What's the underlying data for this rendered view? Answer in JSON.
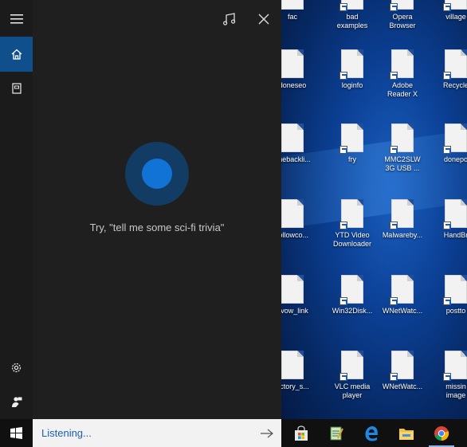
{
  "cortana": {
    "hint_text": "Try, \"tell me some sci-fi trivia\"",
    "rail_icons": [
      "hamburger-menu-icon",
      "home-icon",
      "notebook-icon",
      "settings-icon",
      "feedback-icon"
    ],
    "top_icons": [
      "music-note-icon",
      "close-icon"
    ]
  },
  "search": {
    "status_text": "Listening...",
    "submit_icon": "arrow-right-icon"
  },
  "desktop": {
    "icons": [
      {
        "label": "fac"
      },
      {
        "label": "bad\nexamples"
      },
      {
        "label": "Opera\nBrowser"
      },
      {
        "label": "village"
      },
      {
        "label": "doneseo"
      },
      {
        "label": "loginfo"
      },
      {
        "label": "Adobe\nReader X"
      },
      {
        "label": "Recycle"
      },
      {
        "label": "onebackli..."
      },
      {
        "label": "fry"
      },
      {
        "label": "MMC2SLW\n3G USB ..."
      },
      {
        "label": "donepo"
      },
      {
        "label": "followco..."
      },
      {
        "label": "YTD Video\nDownloader"
      },
      {
        "label": "Malwareby..."
      },
      {
        "label": "HandBr"
      },
      {
        "label": "avow_link"
      },
      {
        "label": "Win32Disk..."
      },
      {
        "label": "WNetWatc..."
      },
      {
        "label": "postto"
      },
      {
        "label": "ectory_s..."
      },
      {
        "label": "VLC media\nplayer"
      },
      {
        "label": "WNetWatc..."
      },
      {
        "label": "missin\nimage"
      }
    ]
  },
  "taskbar": {
    "apps": [
      "store-icon",
      "notepad-icon",
      "edge-icon",
      "file-explorer-icon",
      "chrome-icon"
    ]
  },
  "colors": {
    "accent": "#0f4f8c",
    "orb_outer": "#123c63",
    "orb_inner": "#1273d6",
    "listening_text": "#1a5fb4"
  }
}
